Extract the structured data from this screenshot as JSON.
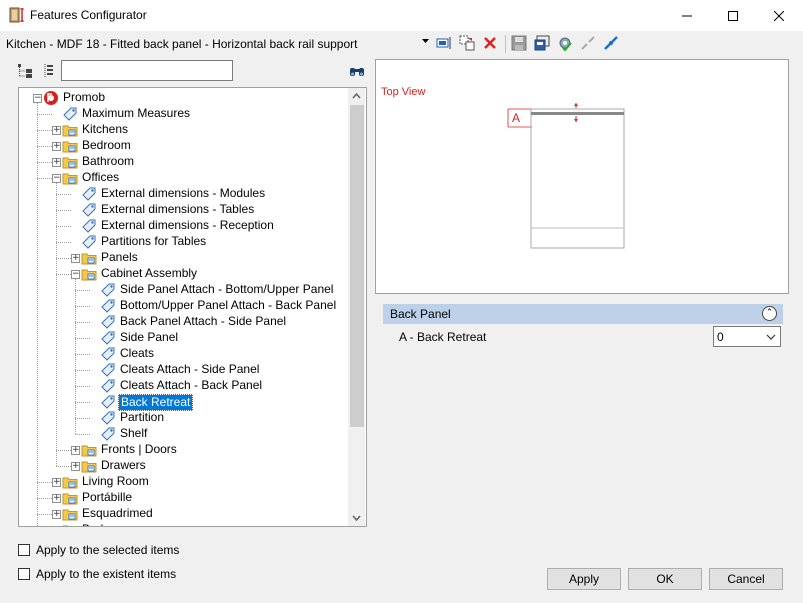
{
  "window": {
    "title": "Features Configurator",
    "minimize_icon": "minimize-icon",
    "maximize_icon": "maximize-icon",
    "close_icon": "close-icon"
  },
  "config_selector": {
    "value": "Kitchen - MDF 18 - Fitted back panel - Horizontal back rail support"
  },
  "toolbar": {
    "icons": [
      "select-items-icon",
      "copy-features-icon",
      "delete-icon",
      "save-icon",
      "import-icon",
      "settings-gear-icon",
      "disconnect-icon",
      "connect-icon"
    ]
  },
  "tree_toolbar": {
    "icons": [
      "tree-expand-icon",
      "tree-columns-icon",
      "binoculars-search-icon"
    ],
    "search_value": ""
  },
  "tree": {
    "items": [
      {
        "label": "Promob",
        "level": 0,
        "expander": "−",
        "icon": "promob-logo-icon"
      },
      {
        "label": "Maximum Measures",
        "level": 1,
        "expander": "",
        "icon": "tag-icon"
      },
      {
        "label": "Kitchens",
        "level": 1,
        "expander": "+",
        "icon": "folder-icon"
      },
      {
        "label": "Bedroom",
        "level": 1,
        "expander": "+",
        "icon": "folder-icon"
      },
      {
        "label": "Bathroom",
        "level": 1,
        "expander": "+",
        "icon": "folder-icon"
      },
      {
        "label": "Offices",
        "level": 1,
        "expander": "−",
        "icon": "folder-icon"
      },
      {
        "label": "External dimensions - Modules",
        "level": 2,
        "expander": "",
        "icon": "tag-icon"
      },
      {
        "label": "External dimensions - Tables",
        "level": 2,
        "expander": "",
        "icon": "tag-icon"
      },
      {
        "label": "External dimensions - Reception",
        "level": 2,
        "expander": "",
        "icon": "tag-icon"
      },
      {
        "label": "Partitions for Tables",
        "level": 2,
        "expander": "",
        "icon": "tag-icon"
      },
      {
        "label": "Panels",
        "level": 2,
        "expander": "+",
        "icon": "folder-icon"
      },
      {
        "label": "Cabinet Assembly",
        "level": 2,
        "expander": "−",
        "icon": "folder-icon"
      },
      {
        "label": "Side Panel Attach - Bottom/Upper Panel",
        "level": 3,
        "expander": "",
        "icon": "tag-icon"
      },
      {
        "label": " Bottom/Upper Panel Attach - Back Panel",
        "level": 3,
        "expander": "",
        "icon": "tag-icon"
      },
      {
        "label": "Back Panel Attach - Side Panel",
        "level": 3,
        "expander": "",
        "icon": "tag-icon"
      },
      {
        "label": "Side Panel",
        "level": 3,
        "expander": "",
        "icon": "tag-icon"
      },
      {
        "label": "Cleats",
        "level": 3,
        "expander": "",
        "icon": "tag-icon"
      },
      {
        "label": "Cleats Attach - Side Panel",
        "level": 3,
        "expander": "",
        "icon": "tag-icon"
      },
      {
        "label": "Cleats Attach - Back Panel",
        "level": 3,
        "expander": "",
        "icon": "tag-icon"
      },
      {
        "label": "Back Retreat",
        "level": 3,
        "expander": "",
        "icon": "tag-icon",
        "selected": true
      },
      {
        "label": "Partition",
        "level": 3,
        "expander": "",
        "icon": "tag-icon"
      },
      {
        "label": "Shelf",
        "level": 3,
        "expander": "",
        "icon": "tag-icon"
      },
      {
        "label": "Fronts | Doors",
        "level": 2,
        "expander": "+",
        "icon": "folder-icon"
      },
      {
        "label": "Drawers",
        "level": 2,
        "expander": "+",
        "icon": "folder-icon"
      },
      {
        "label": "Living Room",
        "level": 1,
        "expander": "+",
        "icon": "folder-icon"
      },
      {
        "label": "Portábille",
        "level": 1,
        "expander": "+",
        "icon": "folder-icon"
      },
      {
        "label": "Esquadrimed",
        "level": 1,
        "expander": "+",
        "icon": "folder-icon"
      },
      {
        "label": "Bedroom",
        "level": 1,
        "expander": "+",
        "icon": "folder-icon"
      }
    ]
  },
  "preview": {
    "label": "Top View",
    "dimension_label": "A"
  },
  "properties": {
    "group_title": "Back Panel",
    "rows": [
      {
        "name": "A - Back Retreat",
        "value": "0"
      }
    ]
  },
  "options": {
    "apply_selected": "Apply to the selected items",
    "apply_existent": "Apply to the existent items"
  },
  "buttons": {
    "apply": "Apply",
    "ok": "OK",
    "cancel": "Cancel"
  },
  "colors": {
    "selection": "#0078d7",
    "group_header": "#bcd0e8",
    "preview_accent": "#dd2222"
  }
}
